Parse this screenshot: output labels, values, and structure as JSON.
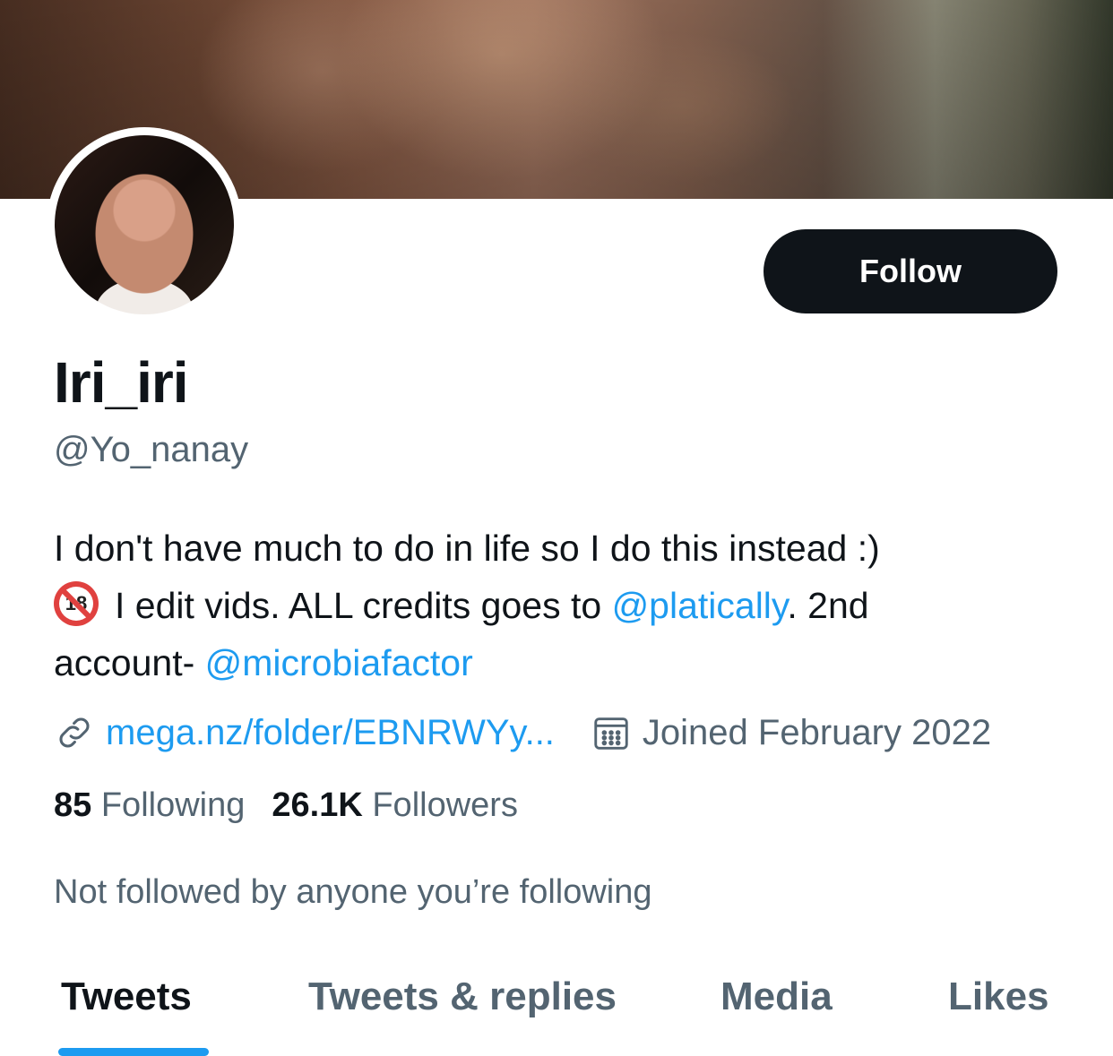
{
  "profile": {
    "display_name": "Iri_iri",
    "handle": "@Yo_nanay",
    "follow_label": "Follow"
  },
  "bio": {
    "line1": "I don't have much to do in life so I do this instead :)",
    "line2_text": "I edit vids. ALL credits goes to ",
    "mention1": "@platically",
    "line2_after": ". 2nd",
    "line3_text": "account- ",
    "mention2": "@microbiafactor",
    "emoji_icon": "no-one-under-18-icon"
  },
  "meta": {
    "url": "mega.nz/folder/EBNRWYy...",
    "joined": "Joined February 2022",
    "link_icon": "link-icon",
    "calendar_icon": "calendar-icon"
  },
  "counts": {
    "following_count": "85",
    "following_label": "Following",
    "followers_count": "26.1K",
    "followers_label": "Followers"
  },
  "not_followed_text": "Not followed by anyone you’re following",
  "tabs": [
    {
      "label": "Tweets",
      "active": true
    },
    {
      "label": "Tweets & replies",
      "active": false
    },
    {
      "label": "Media",
      "active": false
    },
    {
      "label": "Likes",
      "active": false
    }
  ],
  "colors": {
    "accent": "#1d9bf0",
    "text_primary": "#0f1419",
    "text_secondary": "#536471",
    "button_bg": "#0f1419"
  }
}
